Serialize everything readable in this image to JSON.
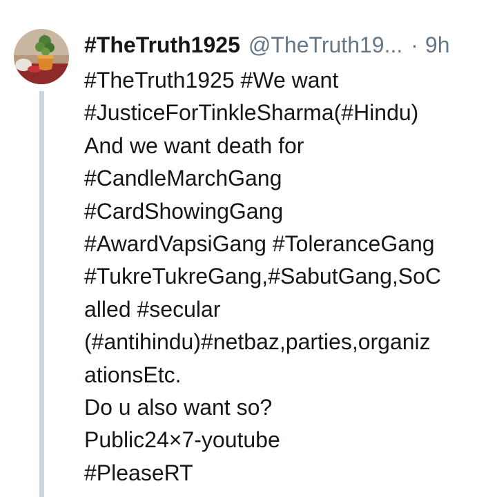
{
  "tweet": {
    "display_name": "#TheTruth1925",
    "handle": "@TheTruth19...",
    "separator": "·",
    "time": "9h",
    "avatar_icon": "avatar-plant-pot-icon",
    "lines": [
      "#TheTruth1925 #We want",
      "#JusticeForTinkleSharma(#Hindu)",
      "And we want death for",
      "#CandleMarchGang",
      "#CardShowingGang",
      "#AwardVapsiGang #ToleranceGang",
      "#TukreTukreGang,#SabutGang,SoC",
      "alled #secular",
      "(#antihindu)#netbaz,parties,organiz",
      "ationsEtc.",
      "Do u also want so?",
      "Public24×7-youtube",
      "#PleaseRT"
    ]
  },
  "colors": {
    "text": "#14171a",
    "secondary": "#657786",
    "thread_line": "#ccd6dd"
  }
}
